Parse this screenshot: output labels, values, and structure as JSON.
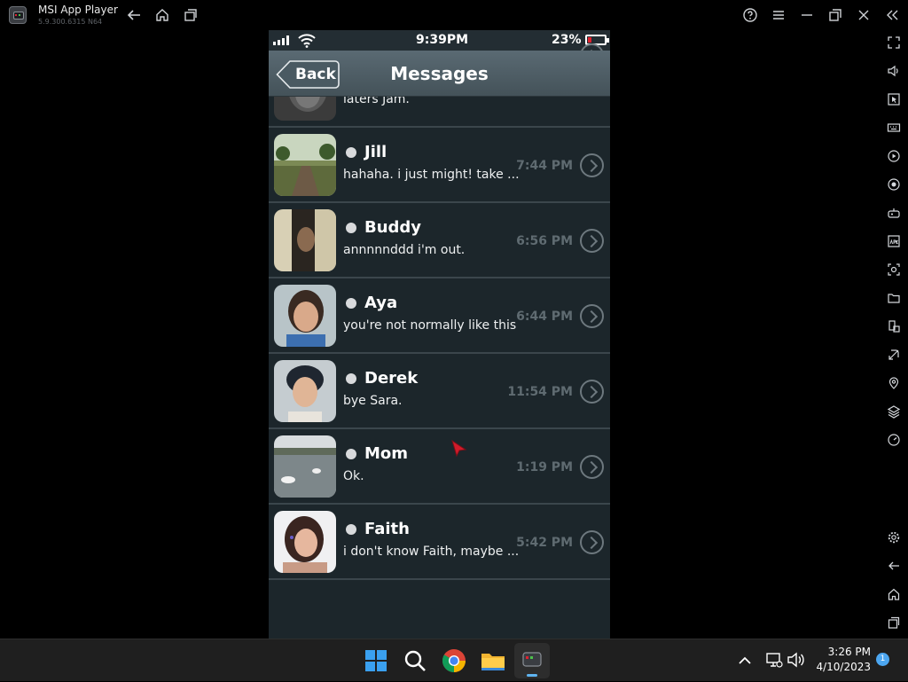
{
  "window": {
    "app_title": "MSI App Player",
    "version": "5.9.300.6315  N64"
  },
  "status_bar": {
    "time": "9:39PM",
    "battery_pct": "23%",
    "battery_level": 0.23
  },
  "nav": {
    "back_label": "Back",
    "title": "Messages"
  },
  "messages": [
    {
      "name": "",
      "preview": "laters Jam.",
      "time": ""
    },
    {
      "name": "Jill",
      "preview": "hahaha. i just might! take ...",
      "time": "7:44 PM"
    },
    {
      "name": "Buddy",
      "preview": "annnnnddd i'm out.",
      "time": "6:56 PM"
    },
    {
      "name": "Aya",
      "preview": "you're not normally like this",
      "time": "6:44 PM"
    },
    {
      "name": "Derek",
      "preview": "bye Sara.",
      "time": "11:54 PM"
    },
    {
      "name": "Mom",
      "preview": "Ok.",
      "time": "1:19 PM"
    },
    {
      "name": "Faith",
      "preview": "i don't know Faith, maybe ...",
      "time": "5:42 PM"
    }
  ],
  "taskbar": {
    "clock_time": "3:26 PM",
    "clock_date": "4/10/2023",
    "notification_count": "1"
  },
  "colors": {
    "accent_red": "#e0212e",
    "screen_bg": "#1c262b",
    "navbar": "#4d5c64"
  }
}
